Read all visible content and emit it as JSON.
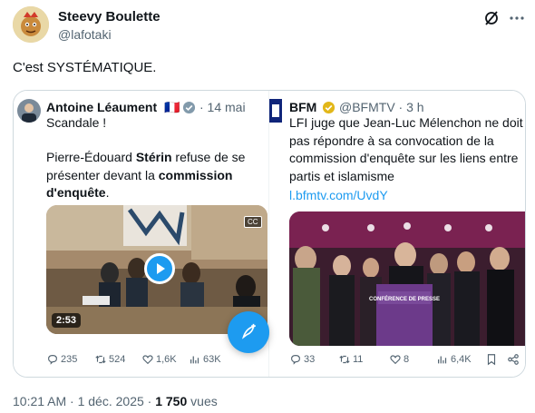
{
  "author": {
    "name": "Steevy Boulette",
    "handle": "@lafotaki"
  },
  "tweet": {
    "text": "C'est SYSTÉMATIQUE."
  },
  "left_tweet": {
    "name": "Antoine Léaument",
    "flag": "🇫🇷",
    "date": "· 14 mai",
    "line1": "Scandale !",
    "body_a": "Pierre-Édouard ",
    "body_b": "Stérin",
    "body_c": " refuse de se présenter devant la ",
    "body_d": "commission d'enquête",
    "body_e": ".",
    "video_time": "2:53",
    "cc_label": "CC",
    "stats": {
      "replies": "235",
      "reposts": "524",
      "likes": "1,6K",
      "views": "63K"
    }
  },
  "right_tweet": {
    "name": "BFM",
    "handle_time": "@BFMTV · 3 h",
    "body": "LFI juge que Jean-Luc Mélenchon ne doit pas répondre à sa convocation de la commission d'enquête sur les liens entre partis et islamisme",
    "link": "l.bfmtv.com/UvdY",
    "podium_text": "CONFÉRENCE DE PRESSE",
    "stats": {
      "replies": "33",
      "reposts": "11",
      "likes": "8",
      "views": "6,4K"
    }
  },
  "footer": {
    "time": "10:21 AM · 1 déc. 2025 · ",
    "views_count": "1 750",
    "views_label": " vues"
  },
  "colors": {
    "accent": "#1d9bf0",
    "muted": "#536471",
    "verified_gold": "#e2b719"
  }
}
